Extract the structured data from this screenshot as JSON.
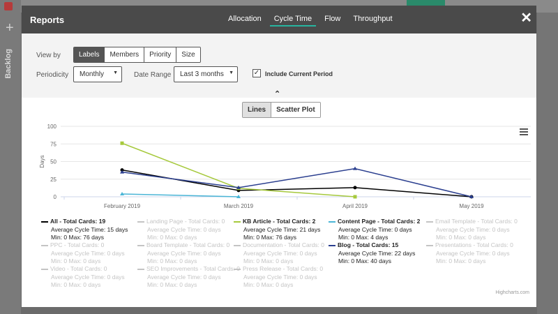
{
  "modal": {
    "title": "Reports",
    "tabs": [
      {
        "label": "Allocation"
      },
      {
        "label": "Cycle Time"
      },
      {
        "label": "Flow"
      },
      {
        "label": "Throughput"
      }
    ],
    "active_tab": "Cycle Time",
    "close_icon": "close-icon"
  },
  "filters": {
    "view_by_label": "View by",
    "view_by": [
      "Labels",
      "Members",
      "Priority",
      "Size"
    ],
    "view_by_active": "Labels",
    "periodicity_label": "Periodicity",
    "periodicity_value": "Monthly",
    "date_range_label": "Date Range",
    "date_range_value": "Last 3 months",
    "include_current_label": "Include Current Period",
    "include_current_checked": true
  },
  "chart_toggle": {
    "options": [
      "Lines",
      "Scatter Plot"
    ],
    "active": "Lines"
  },
  "chart_data": {
    "type": "line",
    "title": "",
    "xlabel": "",
    "ylabel": "Days",
    "categories": [
      "February 2019",
      "March 2019",
      "April 2019",
      "May 2019"
    ],
    "y_ticks": [
      "100",
      "75",
      "50",
      "25",
      "0"
    ],
    "ylim": [
      0,
      100
    ],
    "series": [
      {
        "name": "All",
        "color": "#000000",
        "values": [
          38,
          9,
          13,
          0
        ]
      },
      {
        "name": "KB Article",
        "color": "#a6c93c",
        "values": [
          76,
          12,
          0,
          null
        ]
      },
      {
        "name": "Content Page",
        "color": "#4ab5d6",
        "values": [
          4,
          0,
          null,
          null
        ]
      },
      {
        "name": "Blog",
        "color": "#2b3f8f",
        "values": [
          35,
          13,
          40,
          0
        ]
      }
    ]
  },
  "legend": [
    {
      "name": "All",
      "total": "Total Cards: 19",
      "avg": "Average Cycle Time: 15 days",
      "minmax": "Min: 0 Max: 76 days",
      "active": true,
      "color": "#000000"
    },
    {
      "name": "Landing Page",
      "total": "Total Cards: 0",
      "avg": "Average Cycle Time: 0 days",
      "minmax": "Min: 0 Max: 0 days",
      "active": false,
      "color": "#c4c4c4"
    },
    {
      "name": "KB Article",
      "total": "Total Cards: 2",
      "avg": "Average Cycle Time: 21 days",
      "minmax": "Min: 0 Max: 76 days",
      "active": true,
      "color": "#a6c93c"
    },
    {
      "name": "Content Page",
      "total": "Total Cards: 2",
      "avg": "Average Cycle Time: 0 days",
      "minmax": "Min: 0 Max: 4 days",
      "active": true,
      "color": "#4ab5d6"
    },
    {
      "name": "Email Template",
      "total": "Total Cards: 0",
      "avg": "Average Cycle Time: 0 days",
      "minmax": "Min: 0 Max: 0 days",
      "active": false,
      "color": "#c4c4c4"
    },
    {
      "name": "PPC",
      "total": "Total Cards: 0",
      "avg": "Average Cycle Time: 0 days",
      "minmax": "Min: 0 Max: 0 days",
      "active": false,
      "color": "#c4c4c4"
    },
    {
      "name": "Board Template",
      "total": "Total Cards: 0",
      "avg": "Average Cycle Time: 0 days",
      "minmax": "Min: 0 Max: 0 days",
      "active": false,
      "color": "#c4c4c4"
    },
    {
      "name": "Documentation",
      "total": "Total Cards: 0",
      "avg": "Average Cycle Time: 0 days",
      "minmax": "Min: 0 Max: 0 days",
      "active": false,
      "color": "#c4c4c4"
    },
    {
      "name": "Blog",
      "total": "Total Cards: 15",
      "avg": "Average Cycle Time: 22 days",
      "minmax": "Min: 0 Max: 40 days",
      "active": true,
      "color": "#2b3f8f"
    },
    {
      "name": "Presentations",
      "total": "Total Cards: 0",
      "avg": "Average Cycle Time: 0 days",
      "minmax": "Min: 0 Max: 0 days",
      "active": false,
      "color": "#c4c4c4"
    },
    {
      "name": "Video",
      "total": "Total Cards: 0",
      "avg": "Average Cycle Time: 0 days",
      "minmax": "Min: 0 Max: 0 days",
      "active": false,
      "color": "#c4c4c4"
    },
    {
      "name": "SEO Improvements",
      "total": "Total Cards: 0",
      "avg": "Average Cycle Time: 0 days",
      "minmax": "Min: 0 Max: 0 days",
      "active": false,
      "color": "#c4c4c4"
    },
    {
      "name": "Press Release",
      "total": "Total Cards: 0",
      "avg": "Average Cycle Time: 0 days",
      "minmax": "Min: 0 Max: 0 days",
      "active": false,
      "color": "#c4c4c4"
    }
  ],
  "credits": "Highcharts.com",
  "background": {
    "sidebar_label": "Backlog"
  }
}
